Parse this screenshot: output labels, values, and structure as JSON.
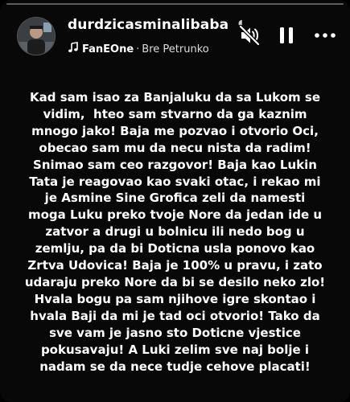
{
  "story": {
    "progress": 0.0
  },
  "header": {
    "username": "durdzicasminalibaba",
    "music": {
      "artist": "FanEOne",
      "separator": "·",
      "song": "Bre Petrunko"
    }
  },
  "icons": {
    "music": "music-note-icon",
    "mute": "speaker-muted-icon",
    "pause": "pause-icon",
    "more": "more-dots-icon"
  },
  "colors": {
    "background": "#000000",
    "text": "#ffffff"
  },
  "caption": {
    "text": "Kad sam isao za Banjaluku da sa Lukom se\nvidim,  hteo sam stvarno da ga kaznim\nmnogo jako! Baja me pozvao i otvorio Oci,\nobecao sam mu da necu nista da radim!\nSnimao sam ceo razgovor! Baja kao Lukin\nTata je reagovao kao svaki otac, i rekao mi\nje Asmine Sine Grofica zeli da namesti\nmoga Luku preko tvoje Nore da jedan ide u\nzatvor a drugi u bolnicu ili nedo bog u\nzemlju, pa da bi Doticna usla ponovo kao\nZrtva Udovica! Baja je 100% u pravu, i zato\nudaraju preko Nore da bi se desilo neko zlo!\nHvala bogu pa sam njihove igre skontao i\nhvala Baji da mi je tad oci otvorio! Tako da\nsve vam je jasno sto Doticne vjestice\npokusavaju! A Luki zelim sve naj bolje i\nnadam se da nece tudje cehove placati!"
  }
}
